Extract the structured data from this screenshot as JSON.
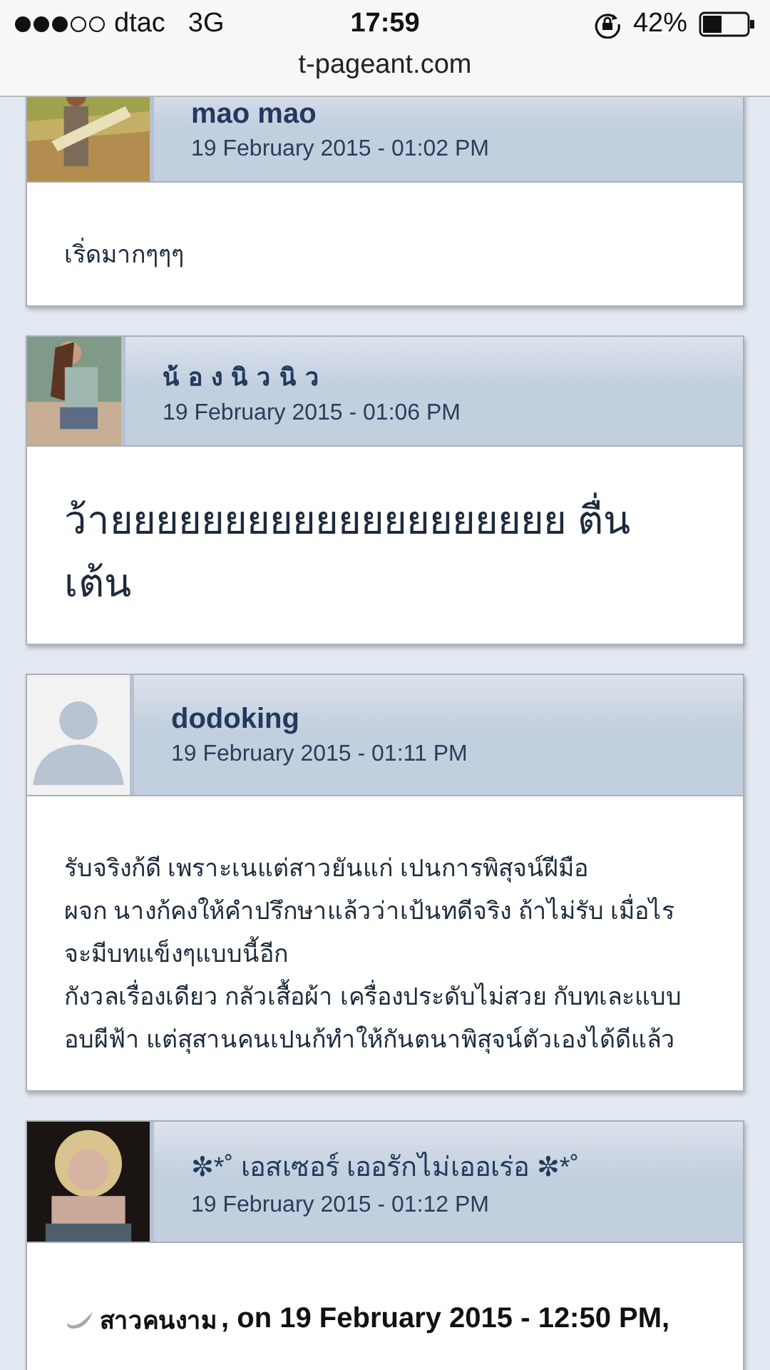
{
  "status_bar": {
    "carrier": "dtac",
    "network": "3G",
    "time": "17:59",
    "battery": "42%"
  },
  "url_bar": {
    "address": "t-pageant.com"
  },
  "posts": [
    {
      "author": {
        "kind": "bold",
        "text": "mao mao"
      },
      "date": "19 February 2015 - 01:02 PM",
      "body": {
        "kind": "text",
        "lines": [
          "เริ่ดมากๆๆๆ"
        ]
      }
    },
    {
      "author": {
        "kind": "spaced",
        "text": "น้องนิวนิว"
      },
      "date": "19 February 2015 - 01:06 PM",
      "body": {
        "kind": "big-text",
        "lines": [
          "ว้ายยยยยยยยยยยยยยยยยยยย ตื่นเต้น"
        ]
      }
    },
    {
      "author": {
        "kind": "bold",
        "text": "dodoking"
      },
      "date": "19 February 2015 - 01:11 PM",
      "avatar": {
        "kind": "silhouette"
      },
      "body": {
        "kind": "text",
        "lines": [
          "รับจริงก้ดี เพราะเนแต่สาวยันแก่ เปนการพิสุจน์ฝีมือ",
          "ผจก นางก้คงให้คำปรึกษาแล้วว่าเป้นทดีจริง ถ้าไม่รับ เมื่อไร",
          "จะมีบทแข็งๆแบบนี้อีก",
          "กังวลเรื่องเดียว กลัวเสื้อผ้า เครื่องประดับไม่สวย กับทเละแบบ",
          "อบผีฟ้า แต่สุสานคนเปนก้ทำให้กันตนาพิสุจน์ตัวเองได้ดีแล้ว"
        ]
      }
    },
    {
      "author": {
        "kind": "plain",
        "text": "✼*˚ เอสเซอร์ เออรักไม่เออเร่อ ✼*˚"
      },
      "date": "19 February 2015 - 01:12 PM",
      "body": {
        "kind": "quote",
        "quote_author": "สาวคนงาม",
        "quote_meta": ", on 19 February 2015 - 12:50 PM,"
      }
    }
  ]
}
